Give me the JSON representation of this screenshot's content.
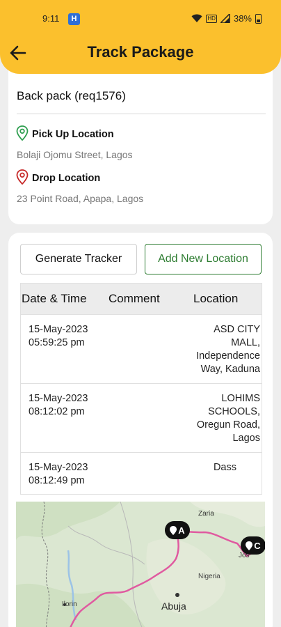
{
  "status_bar": {
    "time": "9:11",
    "app_badge": "H",
    "network": "HD",
    "battery": "38%"
  },
  "header": {
    "title": "Track Package"
  },
  "package": {
    "name": "Back pack  (req1576)",
    "pickup_label": "Pick Up Location",
    "pickup_value": "Bolaji Ojomu Street, Lagos",
    "drop_label": "Drop Location",
    "drop_value": "23 Point Road, Apapa, Lagos"
  },
  "actions": {
    "generate": "Generate Tracker",
    "add_location": "Add New Location"
  },
  "table": {
    "headers": [
      "Date & Time",
      "Comment",
      "Location"
    ],
    "rows": [
      {
        "date": "15-May-2023",
        "time": "05:59:25 pm",
        "comment": "",
        "location": [
          "ASD CITY",
          "MALL,",
          "Independence",
          "Way, Kaduna"
        ]
      },
      {
        "date": "15-May-2023",
        "time": "08:12:02 pm",
        "comment": "",
        "location": [
          "LOHIMS",
          "SCHOOLS,",
          "Oregun Road,",
          "Lagos"
        ]
      },
      {
        "date": "15-May-2023",
        "time": "08:12:49 pm",
        "comment": "",
        "location": [
          "Dass"
        ]
      }
    ]
  },
  "map": {
    "places": {
      "zaria": "Zaria",
      "jos": "Jos",
      "nigeria": "Nigeria",
      "abuja": "Abuja",
      "ilorin": "Ilorin"
    },
    "markers": {
      "a": "A",
      "c": "C"
    },
    "route_color": "#e05aa0"
  },
  "colors": {
    "header": "#fbc02d",
    "accent_green": "#2e7d32",
    "pickup_pin": "#2e9e4f",
    "drop_pin": "#c62828"
  }
}
